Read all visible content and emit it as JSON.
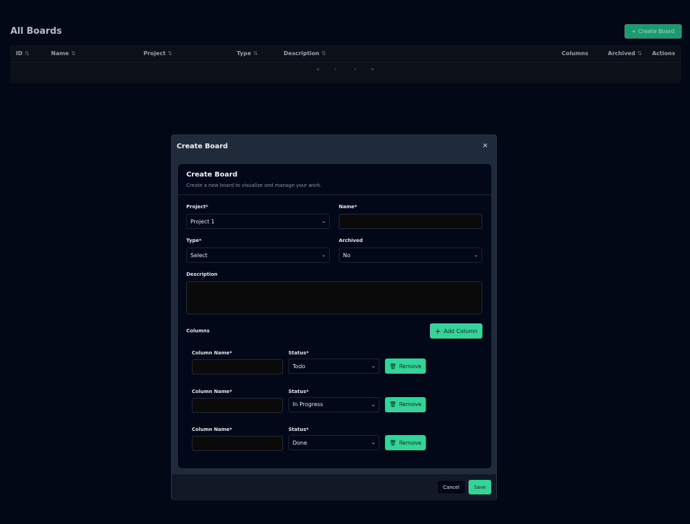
{
  "page": {
    "title": "All Boards",
    "create_button": "Create Board"
  },
  "table": {
    "columns": [
      {
        "label": "ID",
        "sortable": true
      },
      {
        "label": "Name",
        "sortable": true
      },
      {
        "label": "Project",
        "sortable": true
      },
      {
        "label": "Type",
        "sortable": true
      },
      {
        "label": "Description",
        "sortable": true
      },
      {
        "label": "Columns",
        "sortable": false
      },
      {
        "label": "Archived",
        "sortable": true
      },
      {
        "label": "Actions",
        "sortable": false
      }
    ],
    "pagination": {
      "first": "«",
      "prev": "‹",
      "next": "›",
      "last": "»"
    }
  },
  "modal": {
    "title": "Create Board",
    "close": "×",
    "card_title": "Create Board",
    "card_subtitle": "Create a new board to visualize and manage your work.",
    "project_label": "Project*",
    "project_value": "Project 1",
    "name_label": "Name*",
    "name_value": "",
    "type_label": "Type*",
    "type_value": "Select",
    "archived_label": "Archived",
    "archived_value": "No",
    "description_label": "Description",
    "description_value": "",
    "columns_label": "Columns",
    "add_column": "Add Column",
    "columns": [
      {
        "name_label": "Column Name*",
        "name": "",
        "status_label": "Status*",
        "status": "Todo",
        "remove": "Remove"
      },
      {
        "name_label": "Column Name*",
        "name": "",
        "status_label": "Status*",
        "status": "In Progress",
        "remove": "Remove"
      },
      {
        "name_label": "Column Name*",
        "name": "",
        "status_label": "Status*",
        "status": "Done",
        "remove": "Remove"
      }
    ],
    "cancel": "Cancel",
    "save": "Save"
  },
  "colors": {
    "accent": "#34d399",
    "background": "#030816",
    "modal": "#1f2a3b"
  }
}
